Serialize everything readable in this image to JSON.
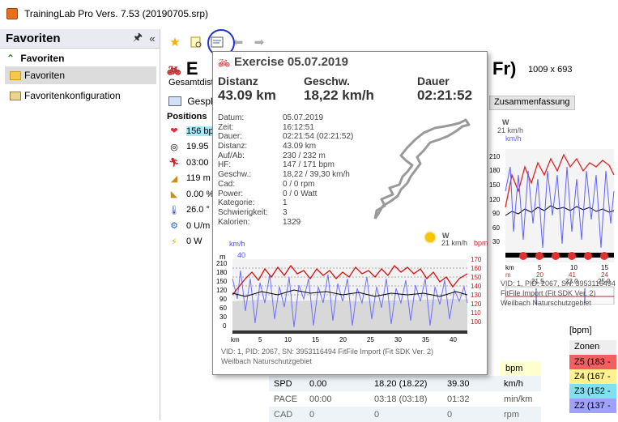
{
  "window": {
    "title": "TrainingLab Pro Vers. 7.53 (20190705.srp)"
  },
  "left_panel": {
    "title": "Favoriten",
    "section": "Favoriten",
    "items": [
      {
        "label": "Favoriten"
      },
      {
        "label": "Favoritenkonfiguration"
      }
    ]
  },
  "main": {
    "title_left": "E",
    "title_right": "Fr)",
    "size": "1009 x 693",
    "subtitle": "Gesamtdista",
    "tab": "Gespl",
    "summary_tab": "Zusammenfassung",
    "position_header": "Positions",
    "position_rows": [
      "156 bp",
      "19.95",
      "03:00",
      "119 m",
      "0.00 %",
      "26.0 °",
      "0 U/m",
      "0 W"
    ],
    "vid": "VID: 1, PID: 2067, SN: 3953116494",
    "fitfile": "FitFile Import (Fit SDK Ver. 2)",
    "location": "Weilbach Naturschutzgebiet",
    "bpm_header": "[bpm]",
    "bpm_unit": "bpm",
    "zones_header": "Zonen",
    "zones": [
      {
        "label": "Z5 (183 -",
        "color": "#f06060"
      },
      {
        "label": "Z4 (167 -",
        "color": "#fff090"
      },
      {
        "label": "Z3 (152 -",
        "color": "#80e0f0"
      },
      {
        "label": "Z2 (137 -",
        "color": "#a0a0ff"
      }
    ],
    "rows": [
      {
        "label": "SPD",
        "a": "0.00",
        "b": "18.20  (18.22)",
        "c": "39.30",
        "unit": "km/h"
      },
      {
        "label": "PACE",
        "a": "00:00",
        "b": "03:18  (03:18)",
        "c": "01:32",
        "unit": "min/km"
      },
      {
        "label": "CAD",
        "a": "0",
        "b": "0",
        "c": "0",
        "unit": "rpm"
      }
    ],
    "right_chart": {
      "w": "W",
      "wind": "21 km/h",
      "kmh": "km/h",
      "yticks": [
        "210",
        "180",
        "150",
        "120",
        "90",
        "60",
        "30"
      ],
      "km_label": "km",
      "m_label": "m",
      "bottom_km": [
        "",
        "5",
        "10",
        "15"
      ],
      "bottom_m": [
        "20",
        "41",
        "24"
      ],
      "bottom_min": [
        "21.5",
        "23.0",
        "25.0"
      ]
    }
  },
  "popup": {
    "title": "Exercise 05.07.2019",
    "distanz_label": "Distanz",
    "distanz": "43.09 km",
    "geschw_label": "Geschw.",
    "geschw": "18,22 km/h",
    "dauer_label": "Dauer",
    "dauer": "02:21:52",
    "details": [
      {
        "k": "Datum:",
        "v": "05.07.2019"
      },
      {
        "k": "Zeit:",
        "v": "16:12:51"
      },
      {
        "k": "Dauer:",
        "v": "02:21:54 (02:21:52)"
      },
      {
        "k": "Distanz:",
        "v": "43.09 km"
      },
      {
        "k": "Auf/Ab:",
        "v": "230 / 232 m"
      },
      {
        "k": "HF:",
        "v": "147 / 171 bpm"
      },
      {
        "k": "Geschw.:",
        "v": "18,22 / 39,30 km/h"
      },
      {
        "k": "Cad:",
        "v": "0 / 0 rpm"
      },
      {
        "k": "Power:",
        "v": "0 / 0 Watt"
      },
      {
        "k": "Kategorie:",
        "v": "1"
      },
      {
        "k": "Schwierigkeit:",
        "v": "3"
      },
      {
        "k": "Kalorien:",
        "v": "1329"
      }
    ],
    "chart": {
      "kmh": "km/h",
      "m": "m",
      "bpm": "bpm",
      "w": "W",
      "wind": "21 km/h",
      "left_ticks": [
        "210",
        "180",
        "150",
        "120",
        "90",
        "60",
        "30",
        "0"
      ],
      "kmh_top": "40",
      "right_ticks": [
        "170",
        "160",
        "150",
        "140",
        "130",
        "120",
        "110",
        "100"
      ],
      "x_ticks": [
        "km",
        "5",
        "10",
        "15",
        "20",
        "25",
        "30",
        "35",
        "40"
      ]
    },
    "vid": "VID: 1, PID: 2067, SN: 3953116494 FitFile Import (Fit SDK Ver. 2)",
    "location": "Weilbach Naturschutzgebiet"
  }
}
